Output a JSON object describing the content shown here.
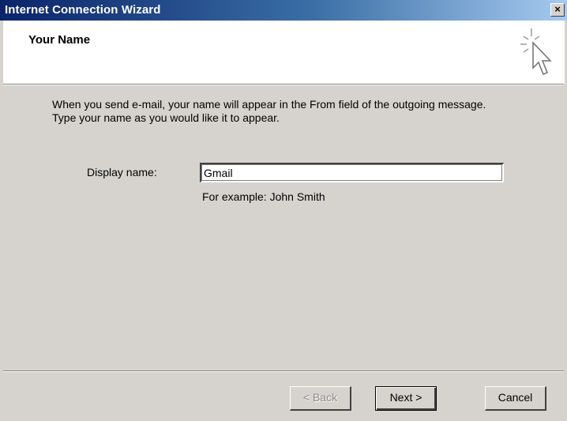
{
  "window": {
    "title": "Internet Connection Wizard",
    "close_label": "×"
  },
  "header": {
    "title": "Your Name",
    "icon": "wizard-sparkle-cursor-icon"
  },
  "body": {
    "line1": "When you send e-mail, your name will appear in the From field of the outgoing message.",
    "line2": "Type your name as you would like it to appear."
  },
  "form": {
    "display_name_label": "Display name:",
    "display_name_value": "Gmail",
    "example": "For example: John Smith"
  },
  "buttons": {
    "back": "< Back",
    "next": "Next >",
    "cancel": "Cancel"
  },
  "colors": {
    "titlebar_start": "#0a246a",
    "titlebar_end": "#a6caf0",
    "dialog_face": "#d6d3ce"
  }
}
